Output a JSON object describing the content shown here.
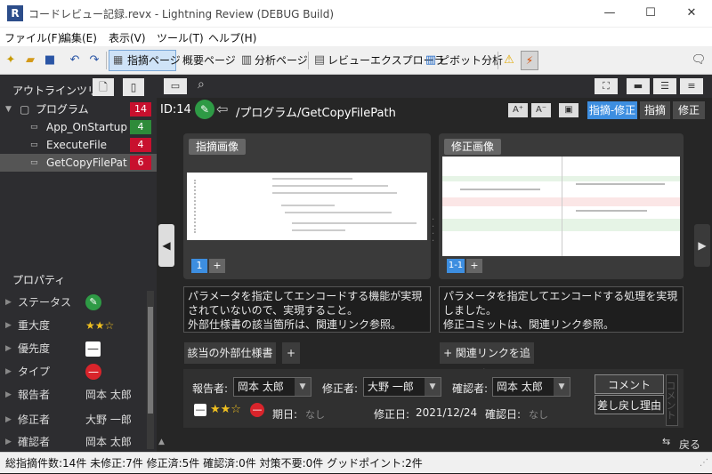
{
  "window": {
    "title": "コードレビュー記録.revx - Lightning Review (DEBUG Build)",
    "app_icon": "R",
    "minimize": "—",
    "maximize": "☐",
    "close": "✕"
  },
  "menu": [
    "ファイル(F)",
    "編集(E)",
    "表示(V)",
    "ツール(T)",
    "ヘルプ(H)"
  ],
  "toolbar": {
    "tabs": [
      "指摘ページ",
      "概要ページ",
      "分析ページ",
      "レビューエクスプローラ",
      "ピボット分析"
    ]
  },
  "outline": {
    "title": "アウトラインツリー",
    "items": [
      {
        "label": "プログラム",
        "count": "14",
        "color": "red"
      },
      {
        "label": "App_OnStartup",
        "count": "4",
        "color": "green"
      },
      {
        "label": "ExecuteFile",
        "count": "4",
        "color": "red"
      },
      {
        "label": "GetCopyFilePat",
        "count": "6",
        "color": "red"
      }
    ]
  },
  "properties": {
    "title": "プロパティ",
    "rows": [
      {
        "label": "ステータス",
        "value": ""
      },
      {
        "label": "重大度",
        "value": "★★☆"
      },
      {
        "label": "優先度",
        "value": ""
      },
      {
        "label": "タイプ",
        "value": ""
      },
      {
        "label": "報告者",
        "value": "岡本 太郎"
      },
      {
        "label": "修正者",
        "value": "大野 一郎"
      },
      {
        "label": "確認者",
        "value": "岡本 太郎"
      }
    ]
  },
  "issue": {
    "id": "ID:14",
    "path": "/プログラム/GetCopyFilePath",
    "modes": [
      "指摘-修正",
      "指摘",
      "修正"
    ]
  },
  "left_panel": {
    "caption": "指摘画像",
    "page_current": "1",
    "page_add": "+",
    "text": "パラメータを指定してエンコードする機能が実現されていないので、実現すること。\n外部仕様書の該当箇所は、関連リンク参照。",
    "link_button": "該当の外部仕様書",
    "link_add": "+"
  },
  "right_panel": {
    "caption": "修正画像",
    "page_current": "1-1",
    "page_add": "+",
    "text": "パラメータを指定してエンコードする処理を実現しました。\n修正コミットは、関連リンク参照。",
    "add_link": "+ 関連リンクを追加"
  },
  "form": {
    "reporter_label": "報告者:",
    "reporter": "岡本 太郎",
    "fixer_label": "修正者:",
    "fixer": "大野 一郎",
    "checker_label": "確認者:",
    "checker": "岡本 太郎",
    "due_label": "期日:",
    "due": "なし",
    "fixed_label": "修正日:",
    "fixed": "2021/12/24",
    "confirm_label": "確認日:",
    "confirm": "なし",
    "stars": "★★☆",
    "comment_btn": "コメント",
    "reject_btn": "差し戻し理由",
    "side_label": "コメント"
  },
  "back": "戻る",
  "status": "総指摘件数:14件  未修正:7件  修正済:5件  確認済:0件  対策不要:0件  グッドポイント:2件"
}
